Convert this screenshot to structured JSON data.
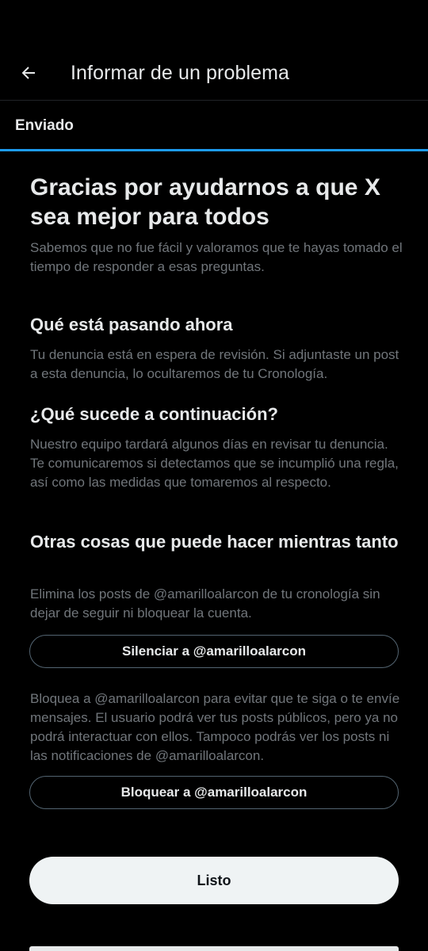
{
  "header": {
    "title": "Informar de un problema",
    "back_icon": "arrow-left-icon"
  },
  "step": {
    "label": "Enviado",
    "progress": 1.0,
    "accent": "#1d9bf0"
  },
  "main": {
    "title": "Gracias por ayudarnos a que X sea mejor para todos",
    "subtitle": "Sabemos que no fue fácil y valoramos que te hayas tomado el tiempo de responder a esas preguntas.",
    "sections": [
      {
        "heading": "Qué está pasando ahora",
        "body": "Tu denuncia está en espera de revisión. Si adjuntaste un post a esta denuncia, lo ocultaremos de tu Cronología."
      },
      {
        "heading": "¿Qué sucede a continuación?",
        "body": "Nuestro equipo tardará algunos días en revisar tu denuncia. Te comunicaremos si detectamos que se incumplió una regla, así como las medidas que tomaremos al respecto."
      },
      {
        "heading": "Otras cosas que puede hacer mientras tanto",
        "body": "Elimina los posts de @amarilloalarcon de tu cronología sin dejar de seguir ni bloquear la cuenta."
      }
    ],
    "mute_button": "Silenciar a @amarilloalarcon",
    "block_text": "Bloquea a @amarilloalarcon para evitar que te siga o te envíe mensajes. El usuario podrá ver tus posts públicos, pero ya no podrá interactuar con ellos. Tampoco podrás ver los posts ni las notificaciones de @amarilloalarcon.",
    "block_button": "Bloquear a @amarilloalarcon"
  },
  "footer": {
    "done_button": "Listo"
  },
  "colors": {
    "background": "#000000",
    "text": "#e7e9ea",
    "secondary_text": "#71767b",
    "button_bg": "#eff3f4"
  }
}
